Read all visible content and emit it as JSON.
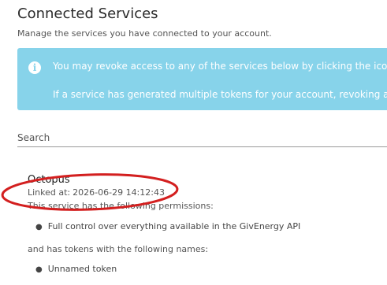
{
  "page": {
    "title": "Connected Services",
    "subtitle": "Manage the services you have connected to your account."
  },
  "info": {
    "icon": "info-icon",
    "line1": "You may revoke access to any of the services below by clicking the icon",
    "line2": "If a service has generated multiple tokens for your account, revoking a"
  },
  "search": {
    "placeholder": "Search",
    "value": ""
  },
  "service": {
    "name": "Octopus",
    "linked_label": "Linked at:",
    "linked_at": "2026-06-29 14:12:43",
    "permissions_heading": "This service has the following permissions:",
    "permissions": [
      "Full control over everything available in the GivEnergy API"
    ],
    "tokens_heading": "and has tokens with the following names:",
    "tokens": [
      "Unnamed token"
    ]
  },
  "colors": {
    "info_background": "#87d3ea",
    "highlight": "#d31f1f"
  }
}
